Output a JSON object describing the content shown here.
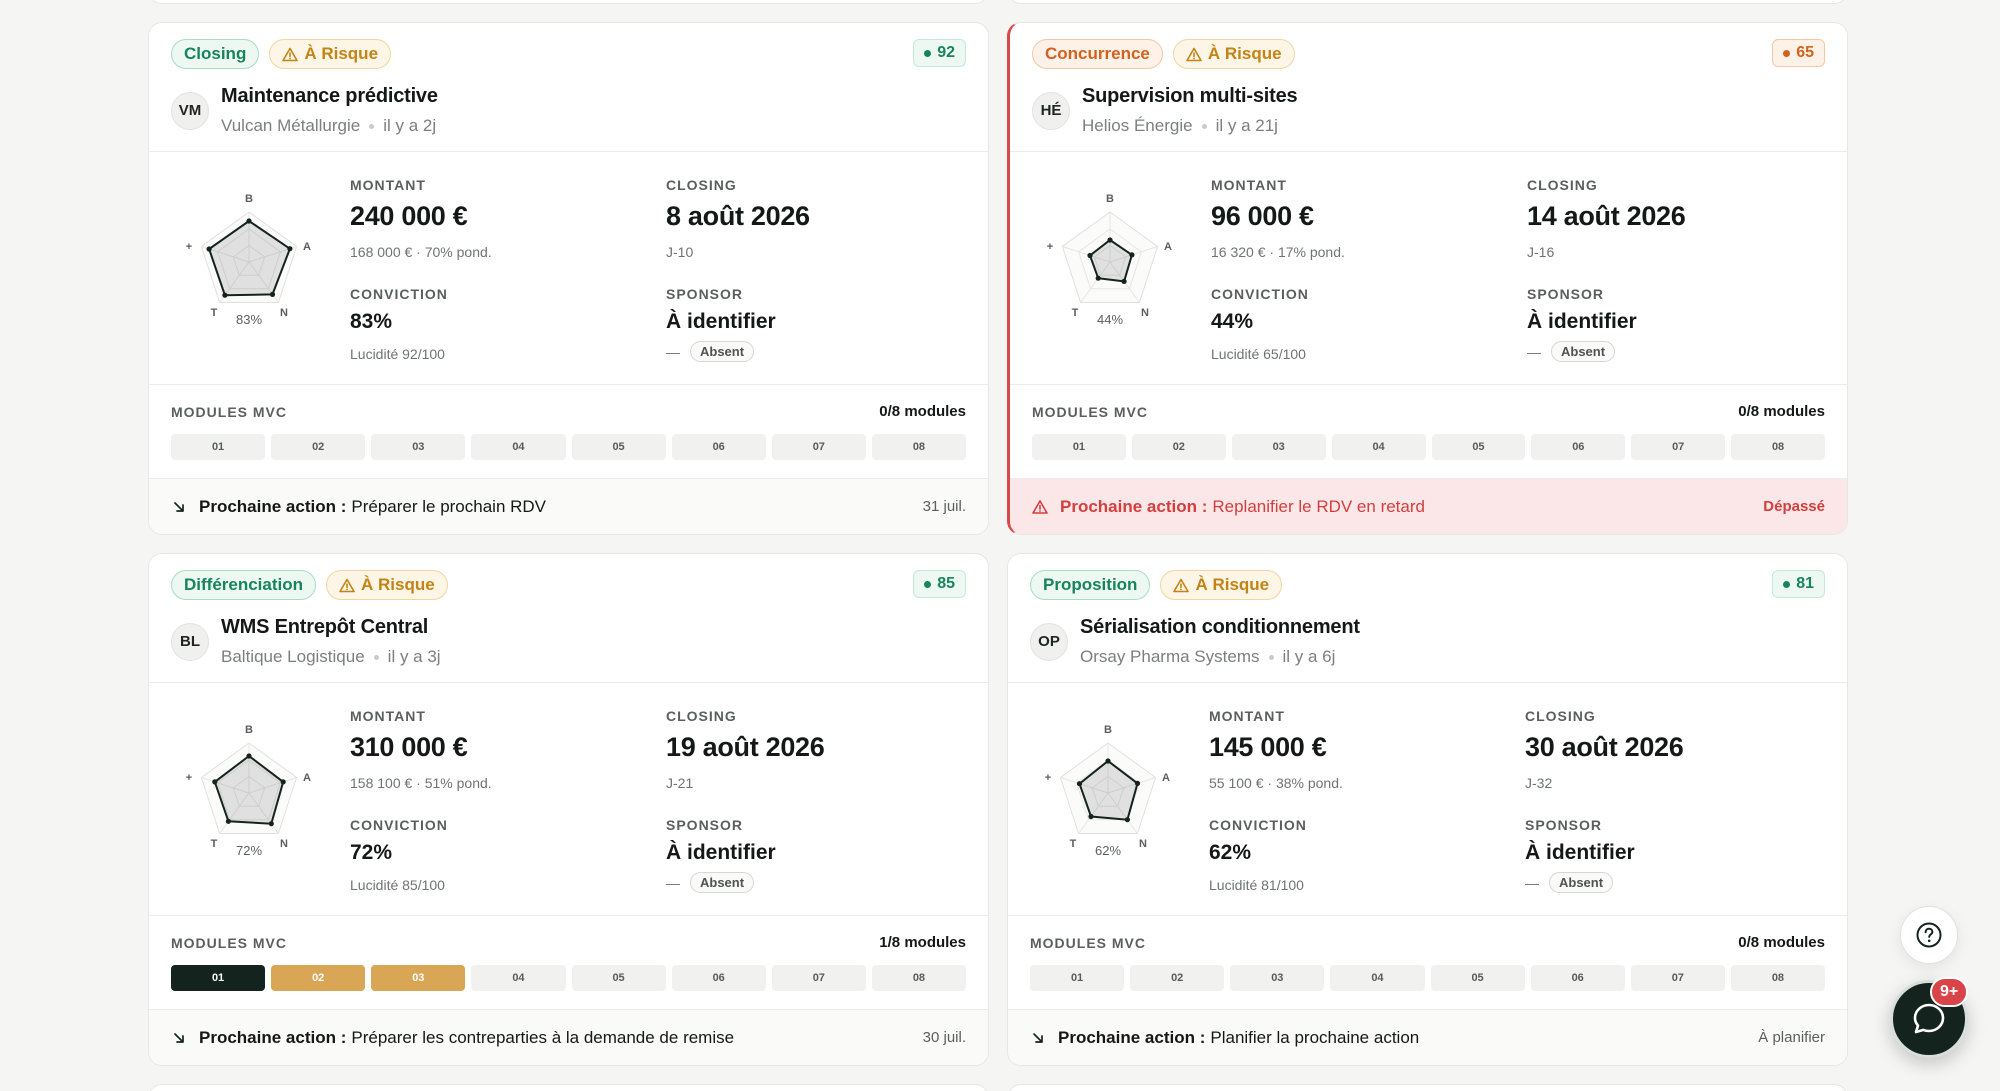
{
  "colors": {
    "accent_dark": "#15231f",
    "module_active": "#d9a655",
    "danger": "#d23f3f",
    "success": "#16855b",
    "risk": "#c48315",
    "stage_orange": "#d2621d"
  },
  "cards": [
    {
      "stage": "Closing",
      "stage_tone": "green",
      "risk": "À Risque",
      "score": "92",
      "score_tone": "green",
      "initials": "VM",
      "title": "Maintenance prédictive",
      "company": "Vulcan Métallurgie",
      "age": "il y a 2j",
      "radar": {
        "axes": [
          "B",
          "A",
          "N",
          "T",
          "+"
        ],
        "pct": "83%",
        "values": [
          0.82,
          0.86,
          0.8,
          0.82,
          0.84
        ]
      },
      "montant_label": "MONTANT",
      "montant": "240 000 €",
      "montant_sub": "168 000 € · 70% pond.",
      "closing_label": "CLOSING",
      "closing": "8 août 2026",
      "closing_sub": "J-10",
      "conviction_label": "CONVICTION",
      "conviction": "83%",
      "conviction_sub": "Lucidité 92/100",
      "sponsor_label": "SPONSOR",
      "sponsor": "À identifier",
      "sponsor_dash": "—",
      "sponsor_status": "Absent",
      "modules_label": "MODULES MVC",
      "modules_count": "0/8 modules",
      "modules": [
        {
          "n": "01",
          "state": "todo"
        },
        {
          "n": "02",
          "state": "todo"
        },
        {
          "n": "03",
          "state": "todo"
        },
        {
          "n": "04",
          "state": "todo"
        },
        {
          "n": "05",
          "state": "todo"
        },
        {
          "n": "06",
          "state": "todo"
        },
        {
          "n": "07",
          "state": "todo"
        },
        {
          "n": "08",
          "state": "todo"
        }
      ],
      "action_key": "Prochaine action :",
      "action": "Préparer le prochain RDV",
      "action_date": "31 juil.",
      "overdue": false
    },
    {
      "stage": "Concurrence",
      "stage_tone": "orange",
      "risk": "À Risque",
      "score": "65",
      "score_tone": "orange",
      "initials": "HÉ",
      "title": "Supervision multi-sites",
      "company": "Helios Énergie",
      "age": "il y a 21j",
      "radar": {
        "axes": [
          "B",
          "A",
          "N",
          "T",
          "+"
        ],
        "pct": "44%",
        "values": [
          0.44,
          0.46,
          0.48,
          0.4,
          0.42
        ]
      },
      "montant_label": "MONTANT",
      "montant": "96 000 €",
      "montant_sub": "16 320 € · 17% pond.",
      "closing_label": "CLOSING",
      "closing": "14 août 2026",
      "closing_sub": "J-16",
      "conviction_label": "CONVICTION",
      "conviction": "44%",
      "conviction_sub": "Lucidité 65/100",
      "sponsor_label": "SPONSOR",
      "sponsor": "À identifier",
      "sponsor_dash": "—",
      "sponsor_status": "Absent",
      "modules_label": "MODULES MVC",
      "modules_count": "0/8 modules",
      "modules": [
        {
          "n": "01",
          "state": "todo"
        },
        {
          "n": "02",
          "state": "todo"
        },
        {
          "n": "03",
          "state": "todo"
        },
        {
          "n": "04",
          "state": "todo"
        },
        {
          "n": "05",
          "state": "todo"
        },
        {
          "n": "06",
          "state": "todo"
        },
        {
          "n": "07",
          "state": "todo"
        },
        {
          "n": "08",
          "state": "todo"
        }
      ],
      "action_key": "Prochaine action :",
      "action": "Replanifier le RDV en retard",
      "action_date": "Dépassé",
      "overdue": true
    },
    {
      "stage": "Différenciation",
      "stage_tone": "green",
      "risk": "À Risque",
      "score": "85",
      "score_tone": "green",
      "initials": "BL",
      "title": "WMS Entrepôt Central",
      "company": "Baltique Logistique",
      "age": "il y a 3j",
      "radar": {
        "axes": [
          "B",
          "A",
          "N",
          "T",
          "+"
        ],
        "pct": "72%",
        "values": [
          0.74,
          0.72,
          0.76,
          0.7,
          0.72
        ]
      },
      "montant_label": "MONTANT",
      "montant": "310 000 €",
      "montant_sub": "158 100 € · 51% pond.",
      "closing_label": "CLOSING",
      "closing": "19 août 2026",
      "closing_sub": "J-21",
      "conviction_label": "CONVICTION",
      "conviction": "72%",
      "conviction_sub": "Lucidité 85/100",
      "sponsor_label": "SPONSOR",
      "sponsor": "À identifier",
      "sponsor_dash": "—",
      "sponsor_status": "Absent",
      "modules_label": "MODULES MVC",
      "modules_count": "1/8 modules",
      "modules": [
        {
          "n": "01",
          "state": "done"
        },
        {
          "n": "02",
          "state": "active"
        },
        {
          "n": "03",
          "state": "active"
        },
        {
          "n": "04",
          "state": "todo"
        },
        {
          "n": "05",
          "state": "todo"
        },
        {
          "n": "06",
          "state": "todo"
        },
        {
          "n": "07",
          "state": "todo"
        },
        {
          "n": "08",
          "state": "todo"
        }
      ],
      "action_key": "Prochaine action :",
      "action": "Préparer les contreparties à la demande de remise",
      "action_date": "30 juil.",
      "overdue": false
    },
    {
      "stage": "Proposition",
      "stage_tone": "green",
      "risk": "À Risque",
      "score": "81",
      "score_tone": "green",
      "initials": "OP",
      "title": "Sérialisation conditionnement",
      "company": "Orsay Pharma Systems",
      "age": "il y a 6j",
      "radar": {
        "axes": [
          "B",
          "A",
          "N",
          "T",
          "+"
        ],
        "pct": "62%",
        "values": [
          0.64,
          0.62,
          0.66,
          0.58,
          0.6
        ]
      },
      "montant_label": "MONTANT",
      "montant": "145 000 €",
      "montant_sub": "55 100 € · 38% pond.",
      "closing_label": "CLOSING",
      "closing": "30 août 2026",
      "closing_sub": "J-32",
      "conviction_label": "CONVICTION",
      "conviction": "62%",
      "conviction_sub": "Lucidité 81/100",
      "sponsor_label": "SPONSOR",
      "sponsor": "À identifier",
      "sponsor_dash": "—",
      "sponsor_status": "Absent",
      "modules_label": "MODULES MVC",
      "modules_count": "0/8 modules",
      "modules": [
        {
          "n": "01",
          "state": "todo"
        },
        {
          "n": "02",
          "state": "todo"
        },
        {
          "n": "03",
          "state": "todo"
        },
        {
          "n": "04",
          "state": "todo"
        },
        {
          "n": "05",
          "state": "todo"
        },
        {
          "n": "06",
          "state": "todo"
        },
        {
          "n": "07",
          "state": "todo"
        },
        {
          "n": "08",
          "state": "todo"
        }
      ],
      "action_key": "Prochaine action :",
      "action": "Planifier la prochaine action",
      "action_date": "À planifier",
      "overdue": false
    }
  ],
  "widgets": {
    "help_icon": "question-circle-icon",
    "chat_icon": "chat-bubble-icon",
    "chat_badge": "9+"
  }
}
